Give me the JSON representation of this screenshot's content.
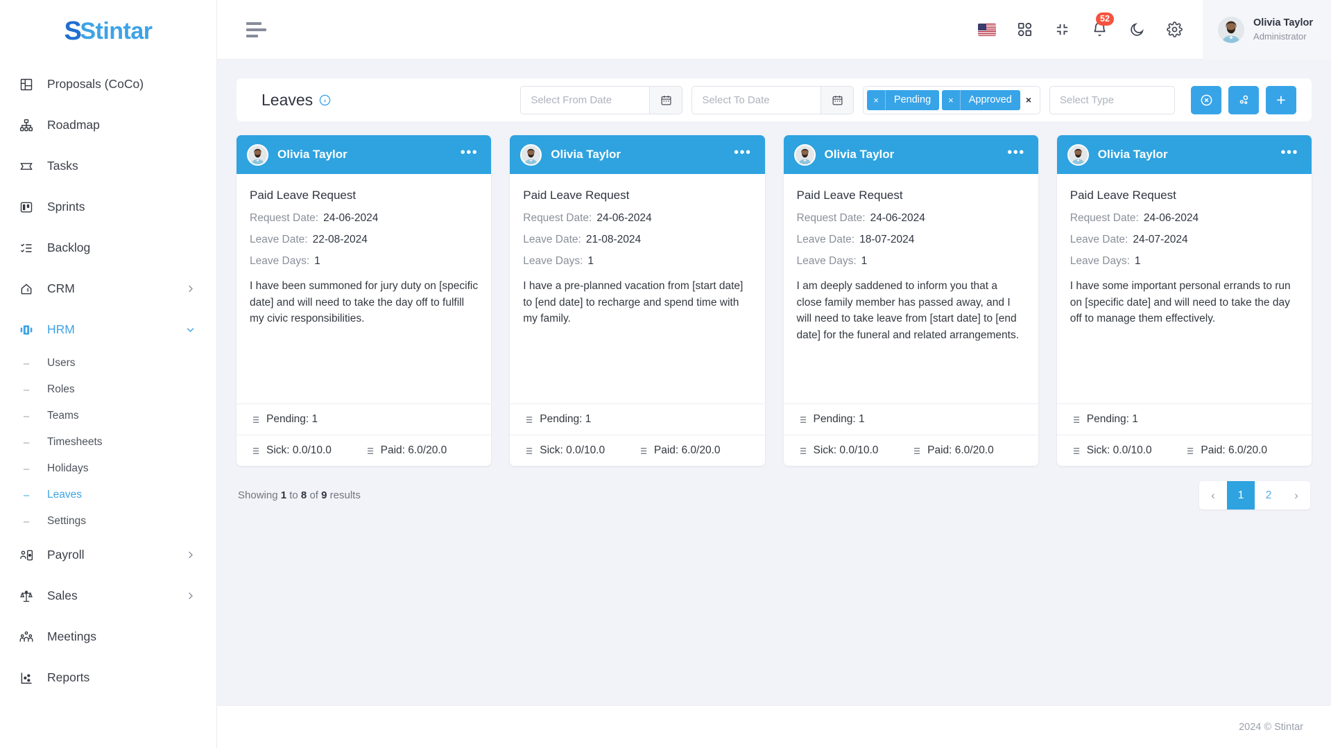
{
  "brand": {
    "name": "Stintar",
    "accent": "#3da3e6"
  },
  "sidebar": {
    "items": [
      {
        "label": "Proposals (CoCo)",
        "icon": "proposals-icon",
        "chevron": ""
      },
      {
        "label": "Roadmap",
        "icon": "roadmap-icon",
        "chevron": ""
      },
      {
        "label": "Tasks",
        "icon": "tasks-icon",
        "chevron": ""
      },
      {
        "label": "Sprints",
        "icon": "sprints-icon",
        "chevron": ""
      },
      {
        "label": "Backlog",
        "icon": "backlog-icon",
        "chevron": ""
      },
      {
        "label": "CRM",
        "icon": "crm-icon",
        "chevron": "chevron-right-icon"
      },
      {
        "label": "HRM",
        "icon": "hrm-icon",
        "chevron": "chevron-down-icon"
      }
    ],
    "hrm_children": [
      {
        "label": "Users"
      },
      {
        "label": "Roles"
      },
      {
        "label": "Teams"
      },
      {
        "label": "Timesheets"
      },
      {
        "label": "Holidays"
      },
      {
        "label": "Leaves"
      },
      {
        "label": "Settings"
      }
    ],
    "tail_items": [
      {
        "label": "Payroll",
        "icon": "payroll-icon",
        "chevron": "chevron-right-icon"
      },
      {
        "label": "Sales",
        "icon": "sales-icon",
        "chevron": "chevron-right-icon"
      },
      {
        "label": "Meetings",
        "icon": "meetings-icon",
        "chevron": ""
      },
      {
        "label": "Reports",
        "icon": "reports-icon",
        "chevron": ""
      }
    ],
    "active_parent": "HRM",
    "active_child": "Leaves"
  },
  "topbar": {
    "menu_toggle": "hamburger-icon",
    "icons": [
      {
        "name": "language-flag-us"
      },
      {
        "name": "apps-grid-icon"
      },
      {
        "name": "fullscreen-exit-icon"
      },
      {
        "name": "notifications-bell-icon",
        "badge": "52"
      },
      {
        "name": "dark-mode-moon-icon"
      },
      {
        "name": "settings-gear-icon"
      }
    ],
    "user": {
      "name": "Olivia Taylor",
      "role": "Administrator"
    }
  },
  "filters": {
    "title": "Leaves",
    "info_icon": "info-circle-icon",
    "from_date": {
      "placeholder": "Select From Date",
      "value": ""
    },
    "to_date": {
      "placeholder": "Select To Date",
      "value": ""
    },
    "status_tags": [
      {
        "label": "Pending",
        "remove": "×"
      },
      {
        "label": "Approved",
        "remove": "×"
      }
    ],
    "clear_all": "×",
    "type_select": {
      "placeholder": "Select Type",
      "value": ""
    },
    "actions": [
      {
        "name": "reset-filters-button",
        "icon": "circle-x-icon"
      },
      {
        "name": "filter-settings-button",
        "icon": "settings-dots-icon"
      },
      {
        "name": "add-leave-button",
        "icon": "plus-icon",
        "label": "+"
      }
    ]
  },
  "cards": [
    {
      "user": "Olivia Taylor",
      "menu": "•••",
      "leave_type": "Paid Leave Request",
      "request_date_label": "Request Date:",
      "request_date": "24-06-2024",
      "leave_date_label": "Leave Date:",
      "leave_date": "22-08-2024",
      "leave_days_label": "Leave Days:",
      "leave_days": "1",
      "reason": "I have been summoned for jury duty on [specific date] and will need to take the day off to fulfill my civic responsibilities.",
      "pending": "Pending: 1",
      "sick": "Sick: 0.0/10.0",
      "paid": "Paid: 6.0/20.0"
    },
    {
      "user": "Olivia Taylor",
      "menu": "•••",
      "leave_type": "Paid Leave Request",
      "request_date_label": "Request Date:",
      "request_date": "24-06-2024",
      "leave_date_label": "Leave Date:",
      "leave_date": "21-08-2024",
      "leave_days_label": "Leave Days:",
      "leave_days": "1",
      "reason": "I have a pre-planned vacation from [start date] to [end date] to recharge and spend time with my family.",
      "pending": "Pending: 1",
      "sick": "Sick: 0.0/10.0",
      "paid": "Paid: 6.0/20.0"
    },
    {
      "user": "Olivia Taylor",
      "menu": "•••",
      "leave_type": "Paid Leave Request",
      "request_date_label": "Request Date:",
      "request_date": "24-06-2024",
      "leave_date_label": "Leave Date:",
      "leave_date": "18-07-2024",
      "leave_days_label": "Leave Days:",
      "leave_days": "1",
      "reason": "I am deeply saddened to inform you that a close family member has passed away, and I will need to take leave from [start date] to [end date] for the funeral and related arrangements.",
      "pending": "Pending: 1",
      "sick": "Sick: 0.0/10.0",
      "paid": "Paid: 6.0/20.0"
    },
    {
      "user": "Olivia Taylor",
      "menu": "•••",
      "leave_type": "Paid Leave Request",
      "request_date_label": "Request Date:",
      "request_date": "24-06-2024",
      "leave_date_label": "Leave Date:",
      "leave_date": "24-07-2024",
      "leave_days_label": "Leave Days:",
      "leave_days": "1",
      "reason": "I have some important personal errands to run on [specific date] and will need to take the day off to manage them effectively.",
      "pending": "Pending: 1",
      "sick": "Sick: 0.0/10.0",
      "paid": "Paid: 6.0/20.0"
    }
  ],
  "pagination": {
    "showing_prefix": "Showing",
    "from": "1",
    "to_word": "to",
    "to": "8",
    "of_word": "of",
    "total": "9",
    "results_word": "results",
    "prev": "‹",
    "pages": [
      "1",
      "2"
    ],
    "current": "1",
    "next": "›"
  },
  "footer": {
    "text": "2024 © Stintar"
  }
}
